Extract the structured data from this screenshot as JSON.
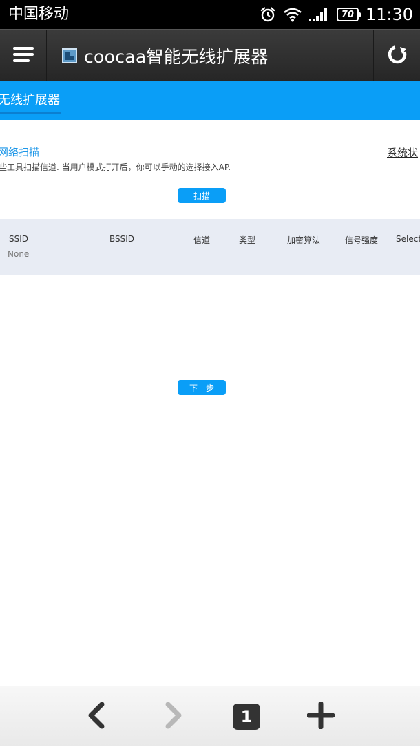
{
  "status_bar": {
    "carrier": "中国移动",
    "battery": "70",
    "time": "11:30"
  },
  "browser": {
    "page_title": "coocaa智能无线扩展器",
    "tab_count": "1"
  },
  "page": {
    "header_title": "无线扩展器",
    "section_title": "网络扫描",
    "status_link": "系统状",
    "description": "些工具扫描信道. 当用户模式打开后，你可以手动的选择接入AP.",
    "scan_button": "扫描",
    "next_button": "下一步"
  },
  "table": {
    "columns": [
      "SSID",
      "BSSID",
      "信道",
      "类型",
      "加密算法",
      "信号强度",
      "Select"
    ],
    "empty_value": "None"
  },
  "colors": {
    "accent": "#0a9ef7",
    "title_bar": "#2e2e2e",
    "table_bg": "#e8ecf4"
  }
}
